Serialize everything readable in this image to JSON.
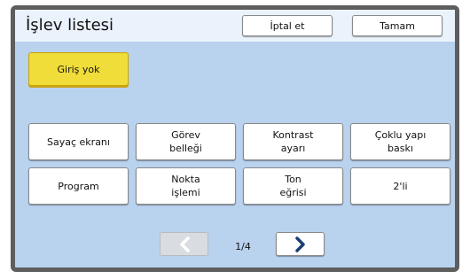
{
  "title": "İşlev listesi",
  "header_buttons": {
    "cancel": "İptal et",
    "ok": "Tamam"
  },
  "no_input_button": "Giriş yok",
  "functions": [
    "Sayaç ekranı",
    "Görev\nbelleği",
    "Kontrast\nayarı",
    "Çoklu yapı\nbaskı",
    "Program",
    "Nokta\nişlemi",
    "Ton\neğrisi",
    "2'li"
  ],
  "pagination": {
    "page": "1/4",
    "prev_icon": "chevron-left-icon",
    "next_icon": "chevron-right-icon"
  },
  "colors": {
    "panel": "#b9d2ee",
    "title_bar": "#eaf2fb",
    "frame": "#5e5e5e",
    "highlight_button": "#f0dd3a",
    "chevron": "#1b3f73",
    "chevron_disabled": "#ffffff"
  }
}
